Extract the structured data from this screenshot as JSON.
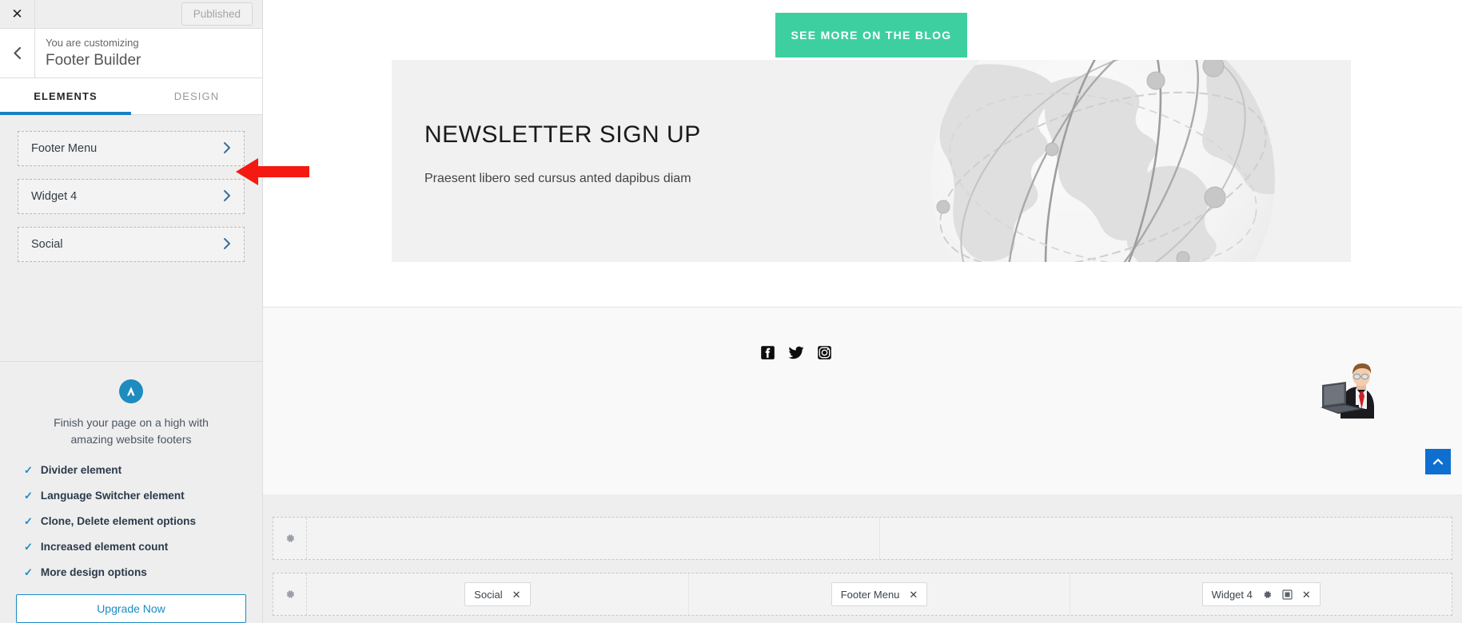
{
  "customizer": {
    "close_icon": "close-icon",
    "published_label": "Published",
    "back_icon": "chevron-left-icon",
    "customizing_label": "You are customizing",
    "panel_title": "Footer Builder",
    "tabs": [
      {
        "label": "ELEMENTS",
        "active": true
      },
      {
        "label": "DESIGN",
        "active": false
      }
    ],
    "elements": [
      {
        "label": "Footer Menu",
        "chevron": "chevron-right-icon"
      },
      {
        "label": "Widget 4",
        "chevron": "chevron-right-icon"
      },
      {
        "label": "Social",
        "chevron": "chevron-right-icon"
      }
    ],
    "promo": {
      "logo_icon": "astra-logo-icon",
      "headline": "Finish your page on a high with amazing website footers",
      "features": [
        "Divider element",
        "Language Switcher element",
        "Clone, Delete element options",
        "Increased element count",
        "More design options"
      ],
      "check_icon": "check-icon",
      "upgrade_label": "Upgrade Now"
    }
  },
  "preview": {
    "cta_label": "SEE MORE ON THE BLOG",
    "newsletter": {
      "title": "NEWSLETTER SIGN UP",
      "subtitle": "Praesent libero sed cursus anted dapibus diam",
      "background_image": "globe-network-image"
    },
    "social_icons": [
      {
        "name": "facebook-icon"
      },
      {
        "name": "twitter-icon"
      },
      {
        "name": "instagram-icon"
      }
    ],
    "illustration": "businessman-with-laptop-image",
    "scroll_top_icon": "chevron-up-icon"
  },
  "footer_builder": {
    "rows": [
      {
        "gear_icon": "gear-icon",
        "columns": [
          {
            "chips": []
          },
          {
            "chips": []
          }
        ]
      },
      {
        "gear_icon": "gear-icon",
        "columns": [
          {
            "chips": [
              {
                "label": "Social",
                "actions": [
                  "close-icon"
                ]
              }
            ]
          },
          {
            "chips": [
              {
                "label": "Footer Menu",
                "actions": [
                  "close-icon"
                ]
              }
            ]
          },
          {
            "chips": [
              {
                "label": "Widget 4",
                "actions": [
                  "gear-icon",
                  "clone-icon",
                  "close-icon"
                ]
              }
            ]
          }
        ]
      }
    ]
  },
  "annotation": {
    "arrow": "red-arrow-pointing-left"
  },
  "colors": {
    "accent_blue": "#1a7fc1",
    "cta_green": "#3ecfa0",
    "scroll_blue": "#0f6fd1",
    "sidebar_bg": "#eeeeee"
  }
}
